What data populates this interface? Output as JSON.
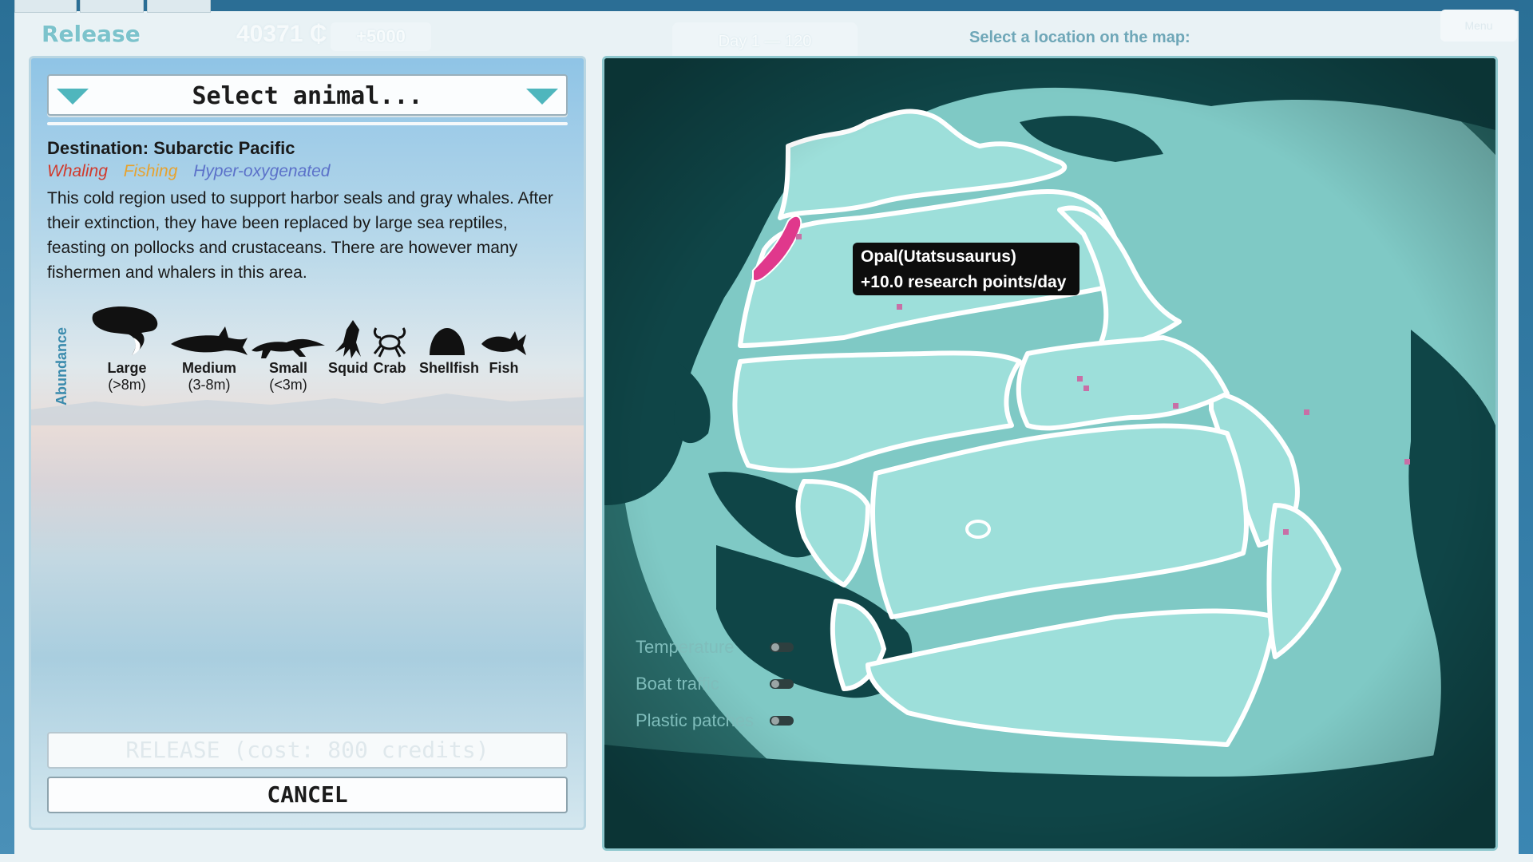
{
  "header": {
    "title": "Release",
    "credits": "40371 ₵",
    "bonus": "+5000",
    "day": "Day 1 — 120",
    "prompt": "Select a location on the map:",
    "menu": "Menu"
  },
  "release_panel": {
    "select_placeholder": "Select animal...",
    "destination": "Destination: Subarctic Pacific",
    "tags": {
      "whaling": "Whaling",
      "fishing": "Fishing",
      "hyper_oxygenated": "Hyper-oxygenated"
    },
    "description": "This cold region used to support harbor seals and  gray whales. After their extinction, they have been replaced by large sea reptiles, feasting on pollocks and crustaceans. There are however many fishermen and whalers in this area.",
    "abundance_label": "Abundance",
    "animals": [
      {
        "name": "Large",
        "size": "(>8m)",
        "icon": "whale-icon"
      },
      {
        "name": "Medium",
        "size": "(3-8m)",
        "icon": "shark-icon"
      },
      {
        "name": "Small",
        "size": "(<3m)",
        "icon": "reptile-icon"
      },
      {
        "name": "Squid",
        "size": "",
        "icon": "squid-icon"
      },
      {
        "name": "Crab",
        "size": "",
        "icon": "crab-icon"
      },
      {
        "name": "Shellfish",
        "size": "",
        "icon": "shellfish-icon"
      },
      {
        "name": "Fish",
        "size": "",
        "icon": "fish-icon"
      }
    ],
    "release_button": "RELEASE (cost: 800 credits)",
    "cancel_button": "CANCEL"
  },
  "map": {
    "tooltip_line1": "Opal(Utatsusaurus)",
    "tooltip_line2": "+10.0 research points/day",
    "toggles": [
      {
        "label": "Temperature",
        "on": false
      },
      {
        "label": "Boat traffic",
        "on": false
      },
      {
        "label": "Plastic patches",
        "on": false
      }
    ],
    "colors": {
      "ocean_highlight": "#9ddfda",
      "land": "#0f4547",
      "region_border": "#ffffff",
      "selected_region": "#e0388c",
      "marker": "#c86fa6"
    }
  }
}
